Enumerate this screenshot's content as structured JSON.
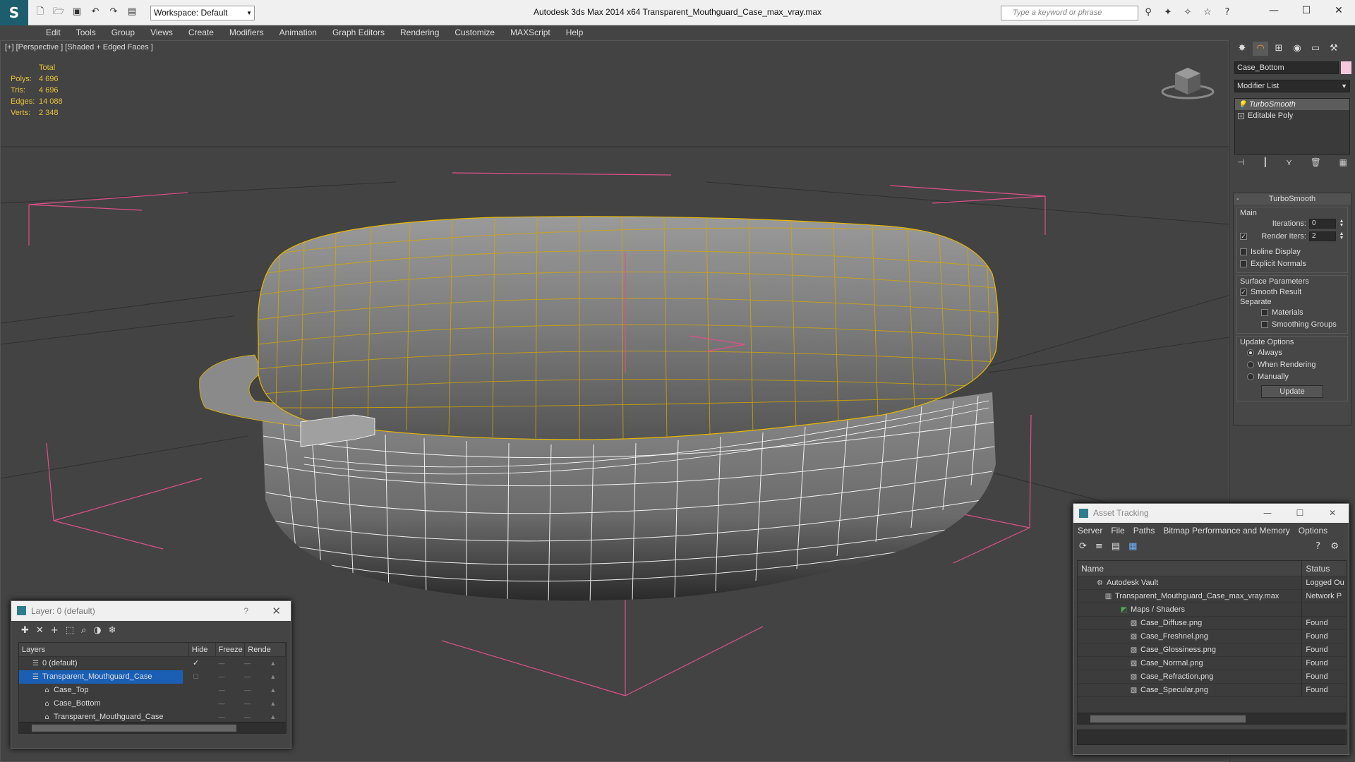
{
  "app": {
    "title": "Autodesk 3ds Max  2014 x64     Transparent_Mouthguard_Case_max_vray.max",
    "workspace": "Workspace: Default",
    "search_placeholder": "Type a keyword or phrase"
  },
  "menu": [
    "Edit",
    "Tools",
    "Group",
    "Views",
    "Create",
    "Modifiers",
    "Animation",
    "Graph Editors",
    "Rendering",
    "Customize",
    "MAXScript",
    "Help"
  ],
  "viewport": {
    "label": "[+] [Perspective ] [Shaded + Edged Faces ]",
    "stats": {
      "header": "Total",
      "rows": [
        {
          "k": "Polys:",
          "v": "4 696"
        },
        {
          "k": "Tris:",
          "v": "4 696"
        },
        {
          "k": "Edges:",
          "v": "14 088"
        },
        {
          "k": "Verts:",
          "v": "2 348"
        }
      ]
    }
  },
  "command_panel": {
    "object_name": "Case_Bottom",
    "object_color": "#f6c8dd",
    "modifier_list": "Modifier List",
    "stack": [
      {
        "label": "TurboSmooth",
        "selected": true
      },
      {
        "label": "Editable Poly",
        "selected": false
      }
    ],
    "turbosmooth": {
      "title": "TurboSmooth",
      "main_label": "Main",
      "iterations_label": "Iterations:",
      "iterations_value": "0",
      "render_iters_label": "Render Iters:",
      "render_iters_value": "2",
      "isoline_display": "Isoline Display",
      "explicit_normals": "Explicit Normals",
      "surface_params": "Surface Parameters",
      "smooth_result": "Smooth Result",
      "separate": "Separate",
      "materials": "Materials",
      "smoothing_groups": "Smoothing Groups",
      "update_options": "Update Options",
      "always": "Always",
      "when_rendering": "When Rendering",
      "manually": "Manually",
      "update_button": "Update"
    }
  },
  "layer_window": {
    "title": "Layer: 0 (default)",
    "help": "?",
    "columns": [
      "Layers",
      "Hide",
      "Freeze",
      "Rende"
    ],
    "rows": [
      {
        "name": "0 (default)",
        "level": 0,
        "selected": false,
        "current": true
      },
      {
        "name": "Transparent_Mouthguard_Case",
        "level": 0,
        "selected": true,
        "current": false
      },
      {
        "name": "Case_Top",
        "level": 1,
        "selected": false,
        "current": false
      },
      {
        "name": "Case_Bottom",
        "level": 1,
        "selected": false,
        "current": false
      },
      {
        "name": "Transparent_Mouthguard_Case",
        "level": 1,
        "selected": false,
        "current": false
      }
    ]
  },
  "asset_window": {
    "title": "Asset Tracking",
    "menu": [
      "Server",
      "File",
      "Paths",
      "Bitmap Performance and Memory",
      "Options"
    ],
    "columns": [
      "Name",
      "Status"
    ],
    "rows": [
      {
        "name": "Autodesk Vault",
        "status": "Logged Ou",
        "level": 0
      },
      {
        "name": "Transparent_Mouthguard_Case_max_vray.max",
        "status": "Network P",
        "level": 1
      },
      {
        "name": "Maps / Shaders",
        "status": "",
        "level": 2
      },
      {
        "name": "Case_Diffuse.png",
        "status": "Found",
        "level": 3
      },
      {
        "name": "Case_Freshnel.png",
        "status": "Found",
        "level": 3
      },
      {
        "name": "Case_Glossiness.png",
        "status": "Found",
        "level": 3
      },
      {
        "name": "Case_Normal.png",
        "status": "Found",
        "level": 3
      },
      {
        "name": "Case_Refraction.png",
        "status": "Found",
        "level": 3
      },
      {
        "name": "Case_Specular.png",
        "status": "Found",
        "level": 3
      }
    ]
  },
  "colors": {
    "wire_selected": "#e6b800",
    "wire_unselected": "#ffffff",
    "bbox": "#e0508a",
    "stats_text": "#e6c23c",
    "selection": "#1a5fb4"
  }
}
